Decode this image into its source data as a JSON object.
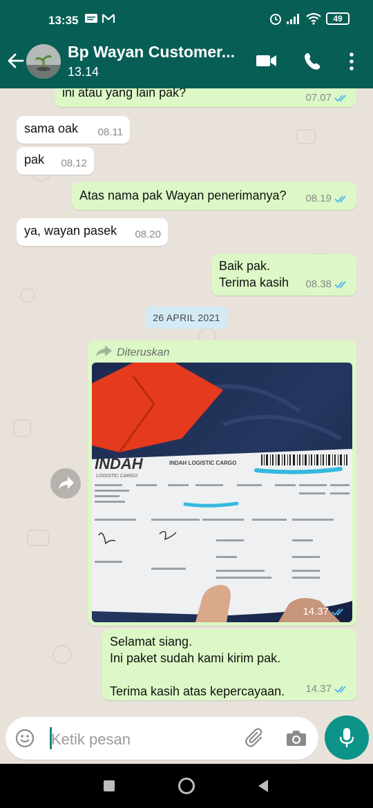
{
  "status_bar": {
    "time": "13:35",
    "battery": "49"
  },
  "header": {
    "contact_name": "Bp Wayan Customer...",
    "status": "13.14"
  },
  "messages": [
    {
      "dir": "out",
      "text": "ini atau yang lain pak?",
      "time": "07.07"
    },
    {
      "dir": "in",
      "text": "sama oak",
      "time": "08.11"
    },
    {
      "dir": "in",
      "text": "pak",
      "time": "08.12"
    },
    {
      "dir": "out",
      "text": "Atas nama pak Wayan penerimanya?",
      "time": "08.19"
    },
    {
      "dir": "in",
      "text": "ya, wayan pasek",
      "time": "08.20"
    },
    {
      "dir": "out",
      "text": "Baik pak.\nTerima kasih",
      "time": "08.38"
    }
  ],
  "date_chip": "26 APRIL 2021",
  "forwarded_image": {
    "forward_label": "Diteruskan",
    "time": "14.37",
    "receipt_brand": "INDAH",
    "receipt_subbrand": "LOGISTIC CARGO",
    "receipt_title": "INDAH LOGISTIC CARGO"
  },
  "last_message": {
    "text": "Selamat siang.\nIni paket sudah kami kirim pak.\n\nTerima kasih atas kepercayaan.",
    "time": "14.37"
  },
  "composer": {
    "placeholder": "Ketik pesan"
  },
  "colors": {
    "header": "#075e55",
    "outgoing": "#dcf8c6",
    "incoming": "#ffffff",
    "tick": "#4fb6ec",
    "fab": "#0d9488",
    "chat_bg": "#e9e2da"
  }
}
